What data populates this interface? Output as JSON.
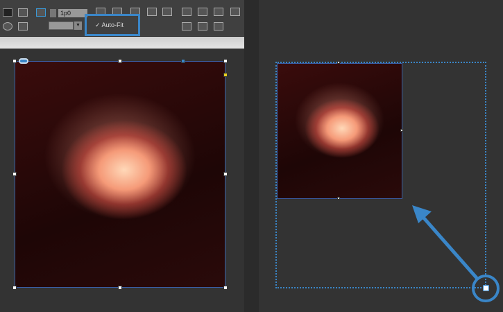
{
  "toolbar": {
    "offset_value": "1p0",
    "autofit_label": "Auto-Fit",
    "autofit_checked": true
  },
  "colors": {
    "accent": "#3a86c8",
    "panel": "#333333"
  }
}
